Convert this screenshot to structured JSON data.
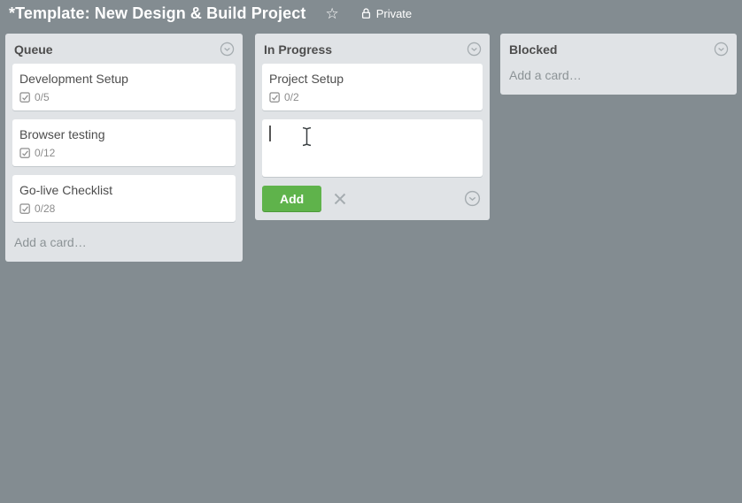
{
  "header": {
    "title": "*Template: New Design & Build Project",
    "privacy_label": "Private"
  },
  "icons": {
    "star": "☆"
  },
  "colors": {
    "board_background": "#838c91",
    "list_background": "#e0e3e6",
    "card_background": "#ffffff",
    "add_button_green": "#5fb34b",
    "text_dark": "#4d4d4d",
    "text_muted": "#8c8c8c",
    "icon_gray": "#a5acb0"
  },
  "board": {
    "lists": [
      {
        "name": "Queue",
        "cards": [
          {
            "title": "Development Setup",
            "checklist_badge": "0/5"
          },
          {
            "title": "Browser testing",
            "checklist_badge": "0/12"
          },
          {
            "title": "Go-live Checklist",
            "checklist_badge": "0/28"
          }
        ],
        "add_card_label": "Add a card…"
      },
      {
        "name": "In Progress",
        "cards": [
          {
            "title": "Project Setup",
            "checklist_badge": "0/2"
          }
        ],
        "composer": {
          "value": "",
          "add_button_label": "Add"
        }
      },
      {
        "name": "Blocked",
        "cards": [],
        "add_card_label": "Add a card…"
      }
    ]
  }
}
